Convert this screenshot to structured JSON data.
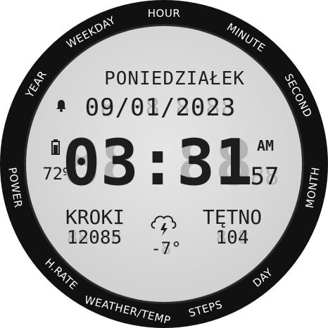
{
  "bezel": {
    "labels": [
      "HOUR",
      "MINUTE",
      "SECOND",
      "MONTH",
      "DAY",
      "STEPS",
      "WEATHER/TEMP",
      "H.RATE",
      "POWER",
      "YEAR",
      "WEEKDAY"
    ]
  },
  "display": {
    "weekday": "PONIEDZIAŁEK",
    "date": "09/01/2023",
    "time": "03:31",
    "ampm": "AM",
    "seconds": "57",
    "battery_percent": "72%",
    "battery_level": 0.72,
    "steps_label": "KROKI",
    "steps_value": "12085",
    "heart_label": "TĘTNO",
    "heart_value": "104",
    "temperature": "-7°"
  },
  "icons": {
    "alarm": "bell-icon",
    "battery": "battery-icon",
    "weather": "thunderstorm-cloud-icon"
  },
  "colors": {
    "bezel": "#111111",
    "lcd_background": "#dedede",
    "lcd_text": "#1d1d1d",
    "lcd_ghost": "#b4b4b4",
    "bezel_text": "#ffffff"
  }
}
